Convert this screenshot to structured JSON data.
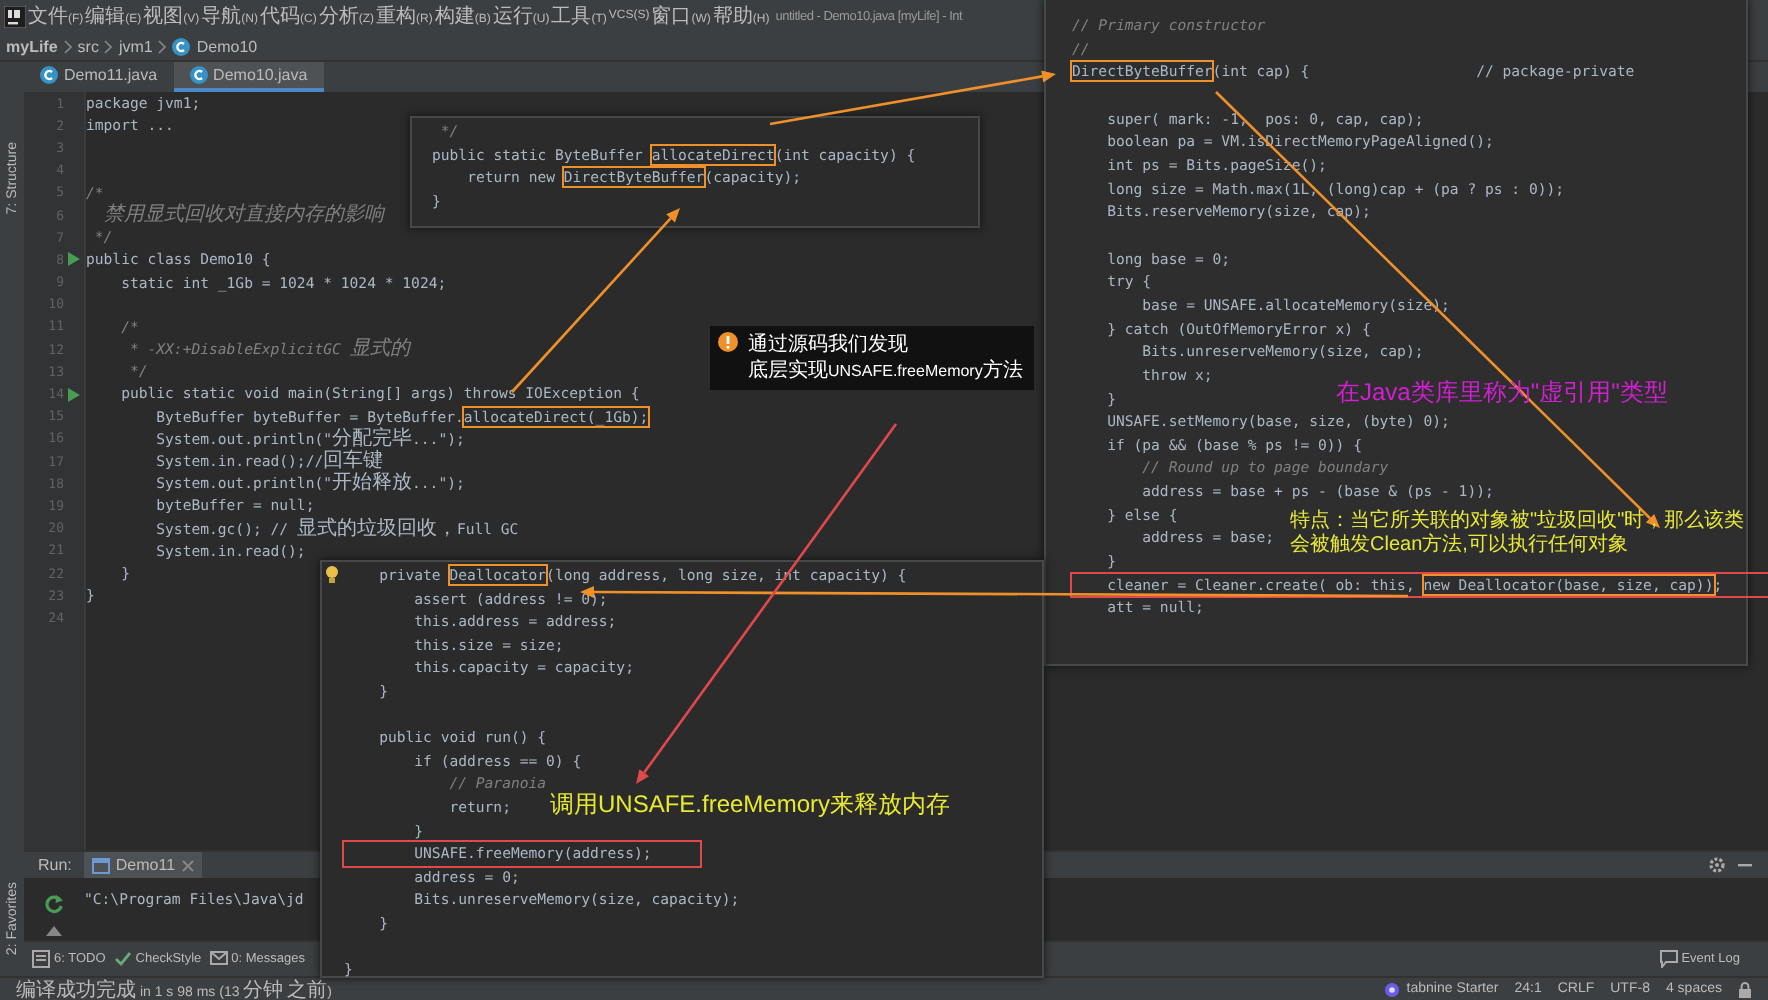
{
  "menu_bar": {
    "items": [
      "文件(F)",
      "编辑(E)",
      "视图(V)",
      "导航(N)",
      "代码(C)",
      "分析(Z)",
      "重构(R)",
      "构建(B)",
      "运行(U)",
      "工具(T)",
      "VCS(S)",
      "窗口(W)",
      "帮助(H)"
    ],
    "window_title": "untitled - Demo10.java [myLife] - Int"
  },
  "breadcrumb": [
    "myLife",
    "src",
    "jvm1",
    "Demo10"
  ],
  "tool_strip": {
    "top": "7: Structure",
    "bottom": "2: Favorites"
  },
  "editor_tabs": [
    {
      "label": "Demo11.java",
      "selected": false
    },
    {
      "label": "Demo10.java",
      "selected": true
    }
  ],
  "editor": {
    "lines": [
      {
        "number": "1",
        "runnable": false,
        "text": "package jvm1;"
      },
      {
        "number": "2",
        "runnable": false,
        "text": "import ..."
      },
      {
        "number": "3",
        "runnable": false
      },
      {
        "number": "4",
        "runnable": false
      },
      {
        "number": "5",
        "runnable": false,
        "kind": "comment",
        "text": "/*"
      },
      {
        "number": "6",
        "runnable": false,
        "kind": "comment",
        "text": "  禁用显式回收对直接内存的影响"
      },
      {
        "number": "7",
        "runnable": false,
        "kind": "comment",
        "text": " */"
      },
      {
        "number": "8",
        "runnable": true,
        "text": "public class Demo10 {"
      },
      {
        "number": "9",
        "runnable": false,
        "text": "    static int _1Gb = 1024 * 1024 * 1024;"
      },
      {
        "number": "10",
        "runnable": false
      },
      {
        "number": "11",
        "runnable": false,
        "kind": "comment",
        "text": "    /*"
      },
      {
        "number": "12",
        "runnable": false,
        "kind": "comment",
        "text": "     * -XX:+DisableExplicitGC 显式的"
      },
      {
        "number": "13",
        "runnable": false,
        "kind": "comment",
        "text": "     */"
      },
      {
        "number": "14",
        "runnable": true,
        "text": "    public static void main(String[] args) throws IOException {"
      },
      {
        "number": "15",
        "runnable": false,
        "parts": [
          {
            "text": "        ByteBuffer byteBuffer = ByteBuffer."
          },
          {
            "text": "allocateDirect(_1Gb);",
            "framed": true
          }
        ]
      },
      {
        "number": "16",
        "runnable": false,
        "text": "        System.out.println(\"分配完毕...\");"
      },
      {
        "number": "17",
        "runnable": false,
        "text": "        System.in.read();//回车键"
      },
      {
        "number": "18",
        "runnable": false,
        "text": "        System.out.println(\"开始释放...\");"
      },
      {
        "number": "19",
        "runnable": false,
        "text": "        byteBuffer = null;"
      },
      {
        "number": "20",
        "runnable": false,
        "text": "        System.gc(); // 显式的垃圾回收，Full GC"
      },
      {
        "number": "21",
        "runnable": false,
        "text": "        System.in.read();"
      },
      {
        "number": "22",
        "runnable": false,
        "text": "    }"
      },
      {
        "number": "23",
        "runnable": false,
        "text": "}"
      },
      {
        "number": "24",
        "runnable": false
      }
    ]
  },
  "popup_allocate": {
    "lines": [
      {
        "kind": "comment",
        "text": " */"
      },
      {
        "parts": [
          {
            "text": "public static ByteBuffer "
          },
          {
            "text": "allocateDirect",
            "framed": true
          },
          {
            "text": "(int capacity) {"
          }
        ]
      },
      {
        "parts": [
          {
            "text": "    return new "
          },
          {
            "text": "DirectByteBuffer",
            "framed": true
          },
          {
            "text": "(capacity);"
          }
        ]
      },
      {
        "text": "}"
      }
    ]
  },
  "popup_constructor": {
    "lines": [
      {
        "kind": "comment",
        "text": "// Primary constructor"
      },
      {
        "kind": "comment",
        "text": "//"
      },
      {
        "parts": [
          {
            "text": "DirectByteBuffer",
            "framed": true
          },
          {
            "text": "(int cap) {                   // package-private"
          }
        ]
      },
      {
        "space_before": true,
        "text": "    super( mark: -1,  pos: 0, cap, cap);"
      },
      {
        "text": "    boolean pa = VM.isDirectMemoryPageAligned();"
      },
      {
        "text": "    int ps = Bits.pageSize();"
      },
      {
        "text": "    long size = Math.max(1L, (long)cap + (pa ? ps : 0));"
      },
      {
        "text": "    Bits.reserveMemory(size, cap);"
      },
      {
        "space_before": true,
        "text": "    long base = 0;"
      },
      {
        "text": "    try {"
      },
      {
        "text": "        base = UNSAFE.allocateMemory(size);"
      },
      {
        "text": "    } catch (OutOfMemoryError x) {"
      },
      {
        "text": "        Bits.unreserveMemory(size, cap);"
      },
      {
        "text": "        throw x;"
      },
      {
        "text": "    }"
      },
      {
        "text": "    UNSAFE.setMemory(base, size, (byte) 0);"
      },
      {
        "text": "    if (pa && (base % ps != 0)) {"
      },
      {
        "kind": "comment",
        "text": "        // Round up to page boundary"
      },
      {
        "text": "        address = base + ps - (base & (ps - 1));"
      },
      {
        "text": "    } else {"
      },
      {
        "text": "        address = base;"
      },
      {
        "text": "    }"
      },
      {
        "outlined": true,
        "parts": [
          {
            "text": "    cleaner = Cleaner.create( ob: this, "
          },
          {
            "text": "new Deallocator(base, size, cap))",
            "framed": true
          },
          {
            "text": ";"
          }
        ]
      },
      {
        "text": "    att = null;"
      }
    ]
  },
  "popup_deallocator": {
    "lines": [
      {
        "parts": [
          {
            "text": "    private "
          },
          {
            "text": "Deallocator",
            "framed": true
          },
          {
            "text": "(long address, long size, int capacity) {"
          }
        ]
      },
      {
        "text": "        assert (address != 0);"
      },
      {
        "text": "        this.address = address;"
      },
      {
        "text": "        this.size = size;"
      },
      {
        "text": "        this.capacity = capacity;"
      },
      {
        "text": "    }"
      },
      {
        "space_before": true,
        "text": "    public void run() {"
      },
      {
        "text": "        if (address == 0) {"
      },
      {
        "kind": "comment",
        "text": "            // Paranoia"
      },
      {
        "text": "            return;"
      },
      {
        "text": "        }"
      },
      {
        "outlined": true,
        "text": "        UNSAFE.freeMemory(address);"
      },
      {
        "text": "        address = 0;"
      },
      {
        "text": "        Bits.unreserveMemory(size, capacity);"
      },
      {
        "text": "    }"
      },
      {
        "space_before": true,
        "text": "}"
      }
    ]
  },
  "tooltip": {
    "lines": [
      "通过源码我们发现",
      "底层实现UNSAFE.freeMemory方法"
    ]
  },
  "note_phantom": "在Java类库里称为\"虚引用\"类型",
  "note_feature": "特点：当它所关联的对象被\"垃圾回收\"时，那么该类会被触发Clean方法,可以执行任何对象",
  "note_free": "调用UNSAFE.freeMemory来释放内存",
  "run_panel": {
    "label": "Run:",
    "tab": "Demo11",
    "console": "\"C:\\Program Files\\Java\\jd"
  },
  "tool_tabs": [
    "6: TODO",
    "CheckStyle",
    "0: Messages"
  ],
  "event_log": "Event Log",
  "status_bar": {
    "message": "编译成功完成 in 1 s 98 ms (13 分钟 之前)",
    "plugin": "tabnine Starter",
    "position": "24:1",
    "line_ending": "CRLF",
    "encoding": "UTF-8",
    "indent": "4 spaces"
  }
}
